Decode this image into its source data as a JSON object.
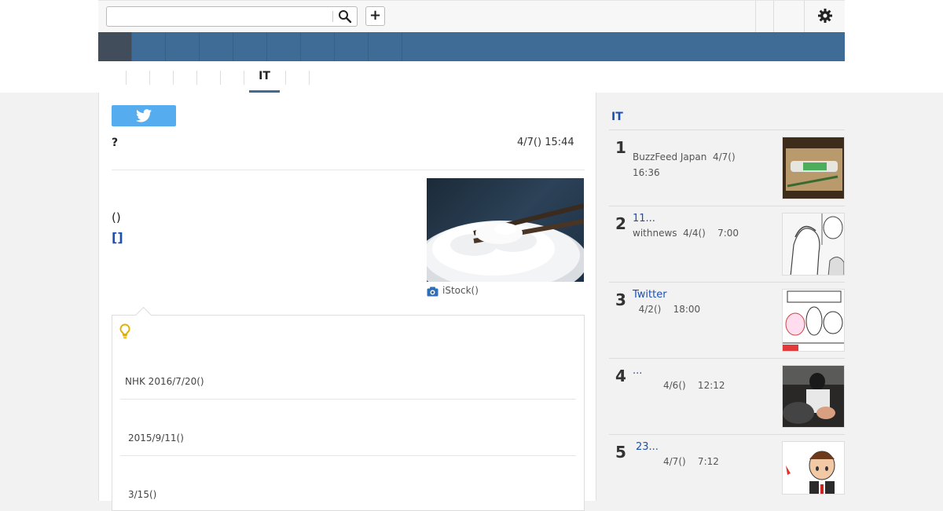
{
  "search": {
    "placeholder": "",
    "value": ""
  },
  "header": {
    "add_label": "+"
  },
  "nav": {
    "item_count": 9,
    "active_index": 0
  },
  "subnav": {
    "active_label": "IT"
  },
  "article": {
    "mark": "?",
    "date": "4/7() 15:44",
    "paren_text": "()",
    "link_text": "[]",
    "photo_caption": "iStock()",
    "info_lines": [
      "NHK 2016/7/20()",
      "2015/9/11()",
      "3/15()"
    ]
  },
  "sidebar": {
    "title": "IT",
    "items": [
      {
        "rank": "1",
        "title": "",
        "meta1": "BuzzFeed Japan  4/7()",
        "meta2": "16:36"
      },
      {
        "rank": "2",
        "title": "11...",
        "meta1": "withnews  4/4()    7:00",
        "meta2": ""
      },
      {
        "rank": "3",
        "title": "Twitter",
        "meta1": "  4/2()    18:00",
        "meta2": ""
      },
      {
        "rank": "4",
        "title": "...",
        "meta1": "4/6()    12:12",
        "meta2": ""
      },
      {
        "rank": "5",
        "title": "23...",
        "meta1": "4/7()    7:12",
        "meta2": ""
      }
    ]
  },
  "colors": {
    "nav_blue": "#3f6c96",
    "nav_active": "#424d5b",
    "link_blue": "#1a4fb3",
    "twitter_blue": "#55acee"
  }
}
